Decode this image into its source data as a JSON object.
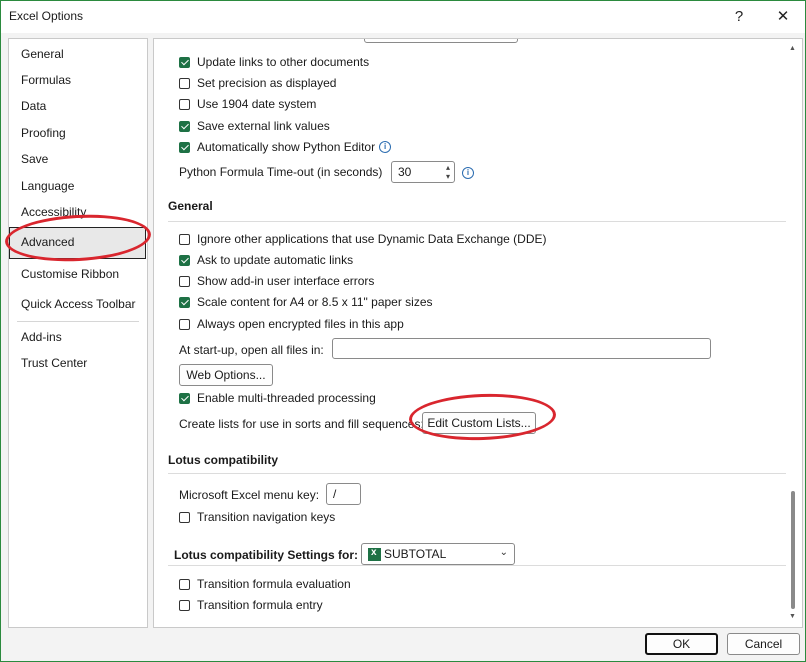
{
  "window": {
    "title": "Excel Options",
    "help_icon": "?",
    "close_icon": "✕"
  },
  "nav": {
    "items": [
      "General",
      "Formulas",
      "Data",
      "Proofing",
      "Save",
      "Language",
      "Accessibility",
      "Advanced",
      "Customise Ribbon",
      "Quick Access Toolbar",
      "Add-ins",
      "Trust Center"
    ],
    "selected": "Advanced"
  },
  "content": {
    "top_options": [
      {
        "label": "Update links to other documents",
        "checked": true
      },
      {
        "label": "Set precision as displayed",
        "checked": false
      },
      {
        "label": "Use 1904 date system",
        "checked": false
      },
      {
        "label": "Save external link values",
        "checked": true
      },
      {
        "label": "Automatically show Python Editor",
        "checked": true
      }
    ],
    "python_timeout": {
      "label": "Python Formula Time-out (in seconds)",
      "value": "30"
    },
    "general": {
      "heading": "General",
      "options": [
        {
          "label": "Ignore other applications that use Dynamic Data Exchange (DDE)",
          "checked": false
        },
        {
          "label": "Ask to update automatic links",
          "checked": true
        },
        {
          "label": "Show add-in user interface errors",
          "checked": false
        },
        {
          "label": "Scale content for A4 or 8.5 x 11\" paper sizes",
          "checked": true
        },
        {
          "label": "Always open encrypted files in this app",
          "checked": false
        }
      ],
      "startup_label": "At start-up, open all files in:",
      "startup_value": "",
      "web_options_button": "Web Options...",
      "multithread": {
        "label": "Enable multi-threaded processing",
        "checked": true
      },
      "custom_lists_label": "Create lists for use in sorts and fill sequences:",
      "custom_lists_button": "Edit Custom Lists..."
    },
    "lotus": {
      "heading": "Lotus compatibility",
      "menu_key_label": "Microsoft Excel menu key:",
      "menu_key_value": "/",
      "transition_nav": {
        "label": "Transition navigation keys",
        "checked": false
      }
    },
    "lotus_settings": {
      "heading": "Lotus compatibility Settings for:",
      "sheet": "SUBTOTAL",
      "options": [
        {
          "label": "Transition formula evaluation",
          "checked": false
        },
        {
          "label": "Transition formula entry",
          "checked": false
        }
      ]
    }
  },
  "footer": {
    "ok": "OK",
    "cancel": "Cancel"
  },
  "colors": {
    "accent": "#1e7145",
    "highlight": "#d9262e",
    "info": "#2b6cb0"
  }
}
